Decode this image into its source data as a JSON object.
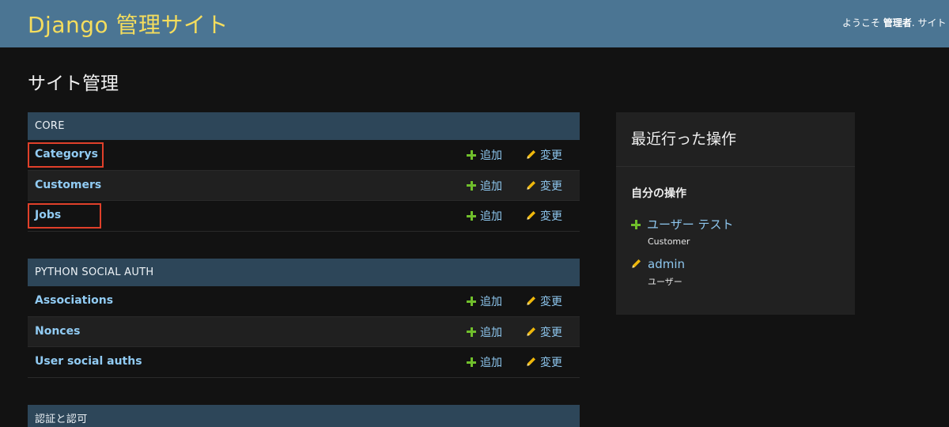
{
  "header": {
    "site_title": "Django 管理サイト",
    "welcome": "ようこそ",
    "username": "管理者",
    "truncated_link": "サイト"
  },
  "page_title": "サイト管理",
  "labels": {
    "add": "追加",
    "change": "変更"
  },
  "modules": [
    {
      "caption": "CORE",
      "rows": [
        {
          "name": "Categorys"
        },
        {
          "name": "Customers"
        },
        {
          "name": "Jobs"
        }
      ]
    },
    {
      "caption": "PYTHON SOCIAL AUTH",
      "rows": [
        {
          "name": "Associations"
        },
        {
          "name": "Nonces"
        },
        {
          "name": "User social auths"
        }
      ]
    },
    {
      "caption": "認証と認可",
      "rows": []
    }
  ],
  "recent_actions": {
    "title": "最近行った操作",
    "my_actions_title": "自分の操作",
    "items": [
      {
        "type": "add",
        "label": "ユーザー テスト",
        "content_type": "Customer"
      },
      {
        "type": "change",
        "label": "admin",
        "content_type": "ユーザー"
      }
    ]
  },
  "colors": {
    "header_bg": "#4b7593",
    "site_title": "#f5dd5d",
    "module_caption_bg": "#2d4659",
    "link": "#8ec7ef",
    "add_icon": "#70bf2b",
    "change_icon": "#efb80b",
    "highlight_box": "#e0402a"
  }
}
